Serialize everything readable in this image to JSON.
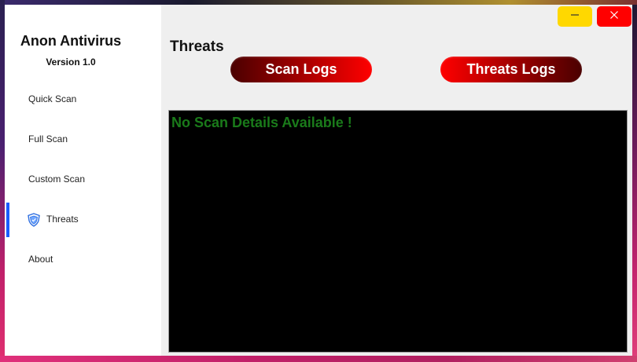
{
  "app": {
    "title": "Anon Antivirus",
    "version": "Version 1.0"
  },
  "sidebar": {
    "items": [
      {
        "label": "Quick Scan",
        "active": false
      },
      {
        "label": "Full Scan",
        "active": false
      },
      {
        "label": "Custom Scan",
        "active": false
      },
      {
        "label": "Threats",
        "active": true,
        "icon": "shield-icon"
      },
      {
        "label": "About",
        "active": false
      }
    ]
  },
  "main": {
    "title": "Threats",
    "scan_logs_label": "Scan Logs",
    "threats_logs_label": "Threats Logs",
    "log_message": "No Scan Details Available !"
  },
  "window_controls": {
    "minimize_icon": "minimize-icon",
    "close_icon": "close-icon"
  },
  "colors": {
    "accent_indicator": "#1a5cff",
    "button_red": "#ff0000",
    "button_dark": "#4a0000",
    "log_text": "#1a7a1a",
    "minimize_yellow": "#ffd800",
    "close_red": "#ff0000"
  }
}
